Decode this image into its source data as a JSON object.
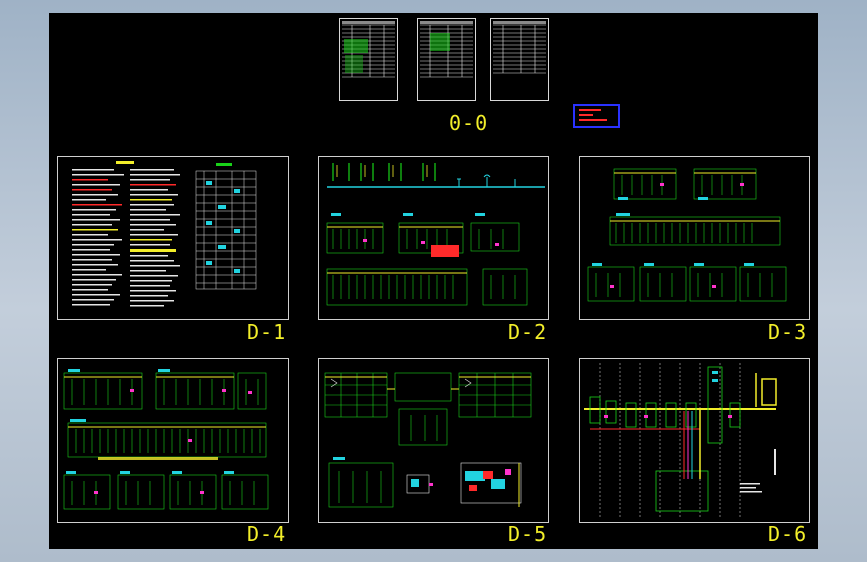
{
  "drawing": {
    "cover_label": "0-0",
    "sheets": [
      {
        "id": "d1",
        "label": "D-1"
      },
      {
        "id": "d2",
        "label": "D-2"
      },
      {
        "id": "d3",
        "label": "D-3"
      },
      {
        "id": "d4",
        "label": "D-4"
      },
      {
        "id": "d5",
        "label": "D-5"
      },
      {
        "id": "d6",
        "label": "D-6"
      }
    ]
  },
  "colors": {
    "canvas": "#000000",
    "sheet_border": "#cfcfcf",
    "label": "#f2ee2a",
    "line_green": "#19d219",
    "line_cyan": "#22d3e0",
    "line_white": "#e6e6e6",
    "line_red": "#ff2a2a",
    "line_yellow": "#f2ee2a",
    "line_magenta": "#ff33cc",
    "legend_border": "#2a32ff"
  }
}
